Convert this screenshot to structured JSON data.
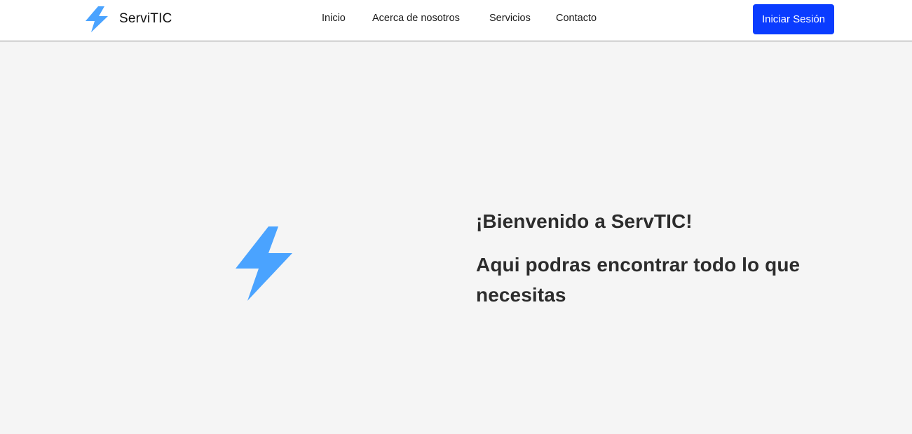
{
  "header": {
    "brand_name": "ServiTIC",
    "brand_icon": "lightning-bolt-icon",
    "nav_items": [
      {
        "label": "Inicio"
      },
      {
        "label": "Acerca de nosotros"
      },
      {
        "label": "Servicios"
      },
      {
        "label": "Contacto"
      }
    ],
    "login_label": "Iniciar Sesión"
  },
  "hero": {
    "icon": "lightning-bolt-icon",
    "title": "¡Bienvenido a ServTIC!",
    "subtitle": "Aqui podras encontrar todo lo que necesitas"
  },
  "colors": {
    "accent": "#0a3cff",
    "icon_blue": "#4aa3ff",
    "background": "#f5f5f5",
    "header_bg": "#ffffff",
    "text_dark": "#2c2c2c"
  }
}
